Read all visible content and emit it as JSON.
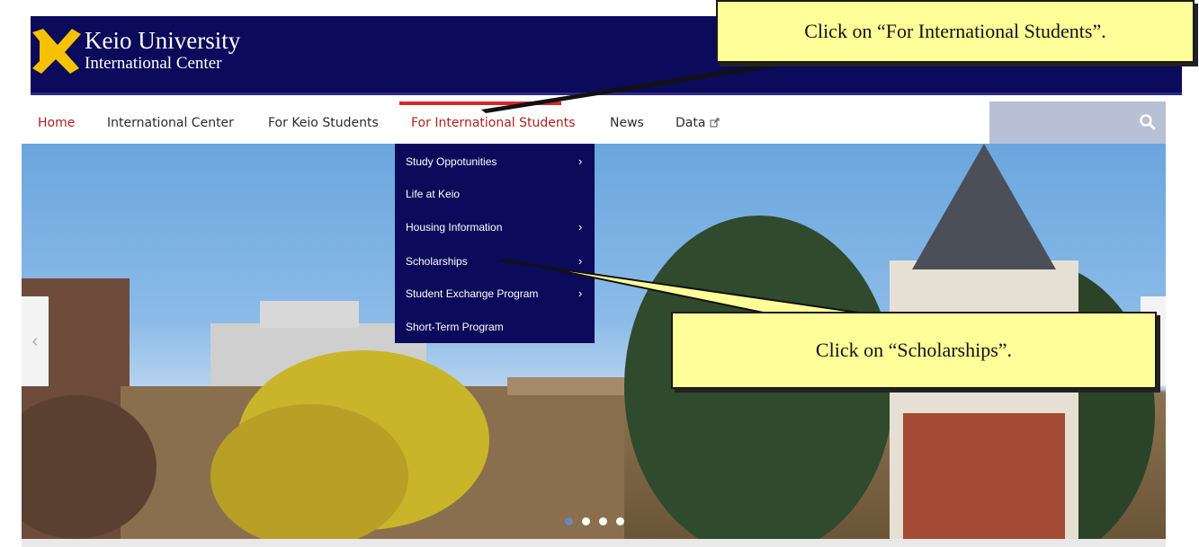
{
  "header": {
    "title": "Keio University",
    "subtitle": "International Center",
    "colors": {
      "navy": "#0c0a5a",
      "accent_red": "#d9262b",
      "logo_yellow": "#f6c200"
    }
  },
  "nav": {
    "items": [
      {
        "label": "Home",
        "active": true
      },
      {
        "label": "International Center"
      },
      {
        "label": "For Keio Students"
      },
      {
        "label": "For International Students",
        "active": true
      },
      {
        "label": "News"
      },
      {
        "label": "Data"
      }
    ],
    "search_icon": "search-icon",
    "external_icon": "external-link-icon"
  },
  "dropdown": {
    "items": [
      {
        "label": "Study Oppotunities",
        "submenu": true
      },
      {
        "label": "Life at Keio",
        "submenu": false
      },
      {
        "label": "Housing Information",
        "submenu": true
      },
      {
        "label": "Scholarships",
        "submenu": true
      },
      {
        "label": "Student Exchange Program",
        "submenu": true
      },
      {
        "label": "Short-Term Program",
        "submenu": false
      }
    ],
    "chevron": "›"
  },
  "carousel": {
    "prev_icon": "‹",
    "dots": 4,
    "active_dot": 1
  },
  "callouts": {
    "first": "Click on “For International Students”.",
    "second": "Click on “Scholarships”."
  }
}
